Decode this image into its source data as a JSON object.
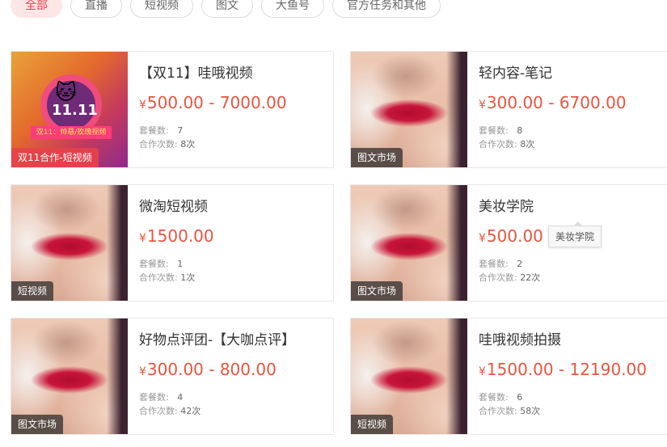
{
  "tabs": [
    {
      "label": "全部",
      "active": true
    },
    {
      "label": "直播",
      "active": false
    },
    {
      "label": "短视频",
      "active": false
    },
    {
      "label": "图文",
      "active": false
    },
    {
      "label": "大鱼号",
      "active": false
    },
    {
      "label": "官方任务和其他",
      "active": false
    }
  ],
  "labels": {
    "packages": "套餐数:",
    "collabs": "合作次数:",
    "currency": "¥"
  },
  "cards": [
    {
      "title": "【双11】哇哦视频",
      "price": "500.00 - 7000.00",
      "packages": "7",
      "collabs": "8次",
      "badge": "双11合作-短视频",
      "image": "promo"
    },
    {
      "title": "轻内容-笔记",
      "price": "300.00 - 6700.00",
      "packages": "8",
      "collabs": "8次",
      "badge": "图文市场",
      "image": "lips"
    },
    {
      "title": "微淘短视频",
      "price": "1500.00",
      "packages": "1",
      "collabs": "1次",
      "badge": "短视频",
      "image": "lips"
    },
    {
      "title": "美妆学院",
      "price": "500.00 - ",
      "packages": "2",
      "collabs": "22次",
      "badge": "图文市场",
      "image": "lips"
    },
    {
      "title": "好物点评团-【大咖点评】",
      "price": "300.00 - 800.00",
      "packages": "4",
      "collabs": "42次",
      "badge": "图文市场",
      "image": "lips"
    },
    {
      "title": "哇哦视频拍摄",
      "price": "1500.00 - 12190.00",
      "packages": "6",
      "collabs": "58次",
      "badge": "短视频",
      "image": "lips"
    }
  ],
  "tooltip": {
    "text": "美妆学院"
  },
  "promo_art": {
    "eleven": "11.11",
    "banner": "双11：帅悬/玫瑰视频"
  },
  "colors": {
    "accent": "#e8414a",
    "price": "#e8553f",
    "active_tab_bg": "#fde6e6"
  }
}
